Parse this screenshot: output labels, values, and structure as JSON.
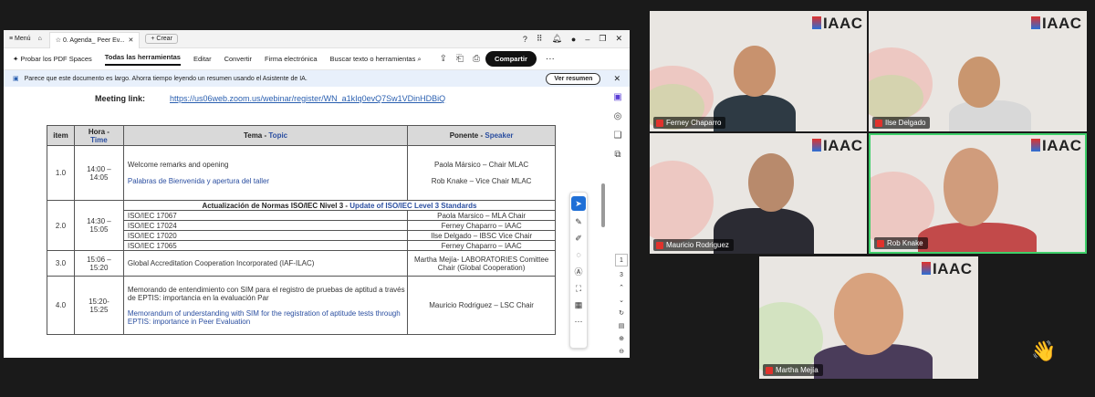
{
  "acrobat": {
    "titlebar": {
      "menu_label": "Menú",
      "tab_title": "0. Agenda_ Peer Ev...",
      "new_button": "+ Crear"
    },
    "toolbar": {
      "try_pdf_spaces": "Probar los PDF Spaces",
      "all_tools": "Todas las herramientas",
      "edit": "Editar",
      "convert": "Convertir",
      "esign": "Firma electrónica",
      "search": "Buscar texto o herramientas",
      "share": "Compartir"
    },
    "banner": {
      "text": "Parece que este documento es largo. Ahorra tiempo leyendo un resumen usando el Asistente de IA.",
      "button": "Ver resumen"
    },
    "page_nav": {
      "current": "1",
      "total": "3"
    }
  },
  "document": {
    "meeting_label": "Meeting link:",
    "meeting_url": "https://us06web.zoom.us/webinar/register/WN_a1kIq0evQ7Sw1VDinHDBiQ",
    "headers": {
      "item_es": "item",
      "hora_es": "Hora -",
      "hora_en": "Time",
      "tema_es": "Tema -",
      "tema_en": "Topic",
      "ponente_es": "Ponente -",
      "ponente_en": "Speaker"
    },
    "rows": {
      "r1": {
        "item": "1.0",
        "time": "14:00 –\n14:05",
        "topic_es": "Welcome remarks and opening",
        "topic_en": "Palabras de Bienvenida y apertura del taller",
        "speaker1": "Paola Mársico – Chair MLAC",
        "speaker2": "Rob Knake – Vice Chair MLAC"
      },
      "r2": {
        "item": "2.0",
        "time": "14:30 –\n15:05",
        "section_es": "Actualización de Normas ISO/IEC Nivel 3 -",
        "section_en": "Update of ISO/IEC Level 3 Standards",
        "subs": [
          {
            "std": "ISO/IEC 17067",
            "speaker": "Paola Marsico – MLA Chair"
          },
          {
            "std": "ISO/IEC 17024",
            "speaker": "Ferney Chaparro – IAAC"
          },
          {
            "std": "ISO/IEC 17020",
            "speaker": "Ilse Delgado – IBSC Vice Chair"
          },
          {
            "std": "ISO/IEC 17065",
            "speaker": "Ferney Chaparro – IAAC"
          }
        ]
      },
      "r3": {
        "item": "3.0",
        "time": "15:06 –\n15:20",
        "topic": "Global Accreditation Cooperation Incorporated (IAF-ILAC)",
        "speaker": "Martha Mejía- LABORATORIES Comittee Chair (Global Cooperation)"
      },
      "r4": {
        "item": "4.0",
        "time": "15:20-\n15:25",
        "topic_es": "Memorando de entendimiento con SIM para el registro de pruebas de aptitud a través de EPTIS: importancia en la evaluación Par",
        "topic_en": "Memorandum of understanding with SIM for the registration of aptitude tests through EPTIS: importance in Peer Evaluation",
        "speaker": "Mauricio Rodriguez – LSC Chair"
      }
    }
  },
  "video": {
    "logo_text": "IAAC",
    "participants": {
      "p1": "Ferney Chaparro",
      "p2": "Ilse Delgado",
      "p3": "Mauricio Rodriguez",
      "p4": "Rob Knake",
      "p5": "Martha Mejía"
    },
    "reaction": "👋"
  },
  "colors": {
    "link": "#2a5fb0",
    "english_text": "#2a4ea0",
    "active_speaker": "#3ecf6a",
    "share_button": "#111111"
  }
}
